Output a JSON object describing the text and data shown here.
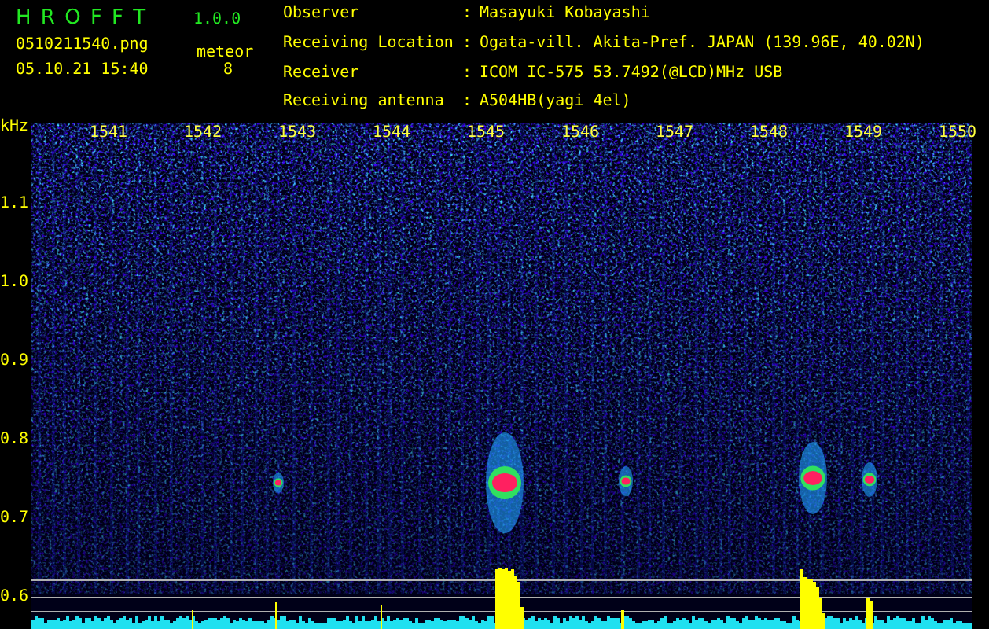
{
  "app": {
    "title": "H R O F F T",
    "version": "1.0.0",
    "file": "0510211540.png",
    "timestamp": "05.10.21 15:40",
    "count_label": "meteor",
    "count": "8"
  },
  "info": [
    {
      "label": "Observer",
      "value": "Masayuki Kobayashi"
    },
    {
      "label": "Receiving Location",
      "value": "Ogata-vill. Akita-Pref. JAPAN (139.96E, 40.02N)"
    },
    {
      "label": "Receiver",
      "value": "ICOM IC-575 53.7492(@LCD)MHz USB"
    },
    {
      "label": "Receiving antenna",
      "value": "A504HB(yagi 4el)"
    }
  ],
  "separator": ":",
  "plot": {
    "unit": "kHz",
    "freq_labels": [
      "1.1",
      "1.0",
      "0.9",
      "0.8",
      "0.7",
      "0.6"
    ],
    "time_labels": [
      "1541",
      "1542",
      "1543",
      "1544",
      "1545",
      "1546",
      "1547",
      "1548",
      "1549",
      "1550"
    ]
  }
}
